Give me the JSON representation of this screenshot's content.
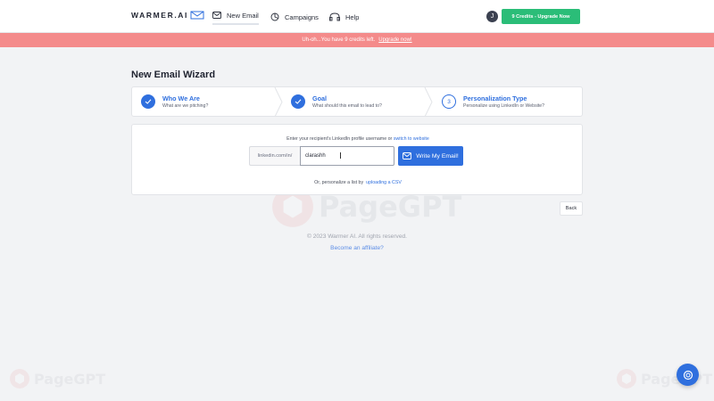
{
  "brand": {
    "name": "WARMER.AI"
  },
  "nav": {
    "new_email": "New Email",
    "campaigns": "Campaigns",
    "help": "Help"
  },
  "user": {
    "initial": "J"
  },
  "credits_button": "9 Credits - Upgrade Now",
  "banner": {
    "text": "Uh-oh...You have 9 credits left.",
    "link": "Upgrade now!"
  },
  "page_title": "New Email Wizard",
  "steps": [
    {
      "title": "Who We Are",
      "subtitle": "What are we pitching?",
      "status": "done"
    },
    {
      "title": "Goal",
      "subtitle": "What should this email to lead to?",
      "status": "done"
    },
    {
      "number": "3",
      "title": "Personalization Type",
      "subtitle": "Personalize using LinkedIn or Website?",
      "status": "current"
    }
  ],
  "form": {
    "hint": "Enter your recipient's LinkedIn profile username or",
    "hint_link": "switch to website",
    "prefix": "linkedin.com/in/",
    "username_value": "clarashh",
    "write_button": "Write My Email!",
    "csv_hint": "Or, personalize a list by",
    "csv_link": "uploading a CSV"
  },
  "back_button": "Back",
  "footer": {
    "copyright": "© 2023 Warmer AI. All rights reserved.",
    "affiliate": "Become an affiliate?"
  },
  "watermark": "PageGPT",
  "colors": {
    "accent": "#2f6fde",
    "success": "#2bbd78",
    "banner": "#f48b8b"
  },
  "icons": [
    "mail-icon",
    "campaigns-icon",
    "help-icon",
    "check-icon",
    "chevron-right-icon",
    "chat-help-icon"
  ]
}
